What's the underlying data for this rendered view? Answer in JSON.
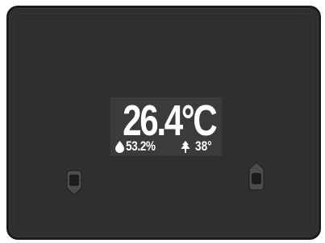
{
  "display": {
    "temperature": "26.4°C",
    "humidity": "53.2%",
    "secondary_value": "38°"
  },
  "icons": {
    "humidity": "water-drop-icon",
    "secondary": "tree-icon",
    "left_button": "chevron-down-icon",
    "right_button": "chevron-up-icon"
  },
  "colors": {
    "device_body": "#2e2f30",
    "device_border": "#1b1b1c",
    "display_background": "#3a3b3c",
    "display_text": "#ffffff"
  }
}
